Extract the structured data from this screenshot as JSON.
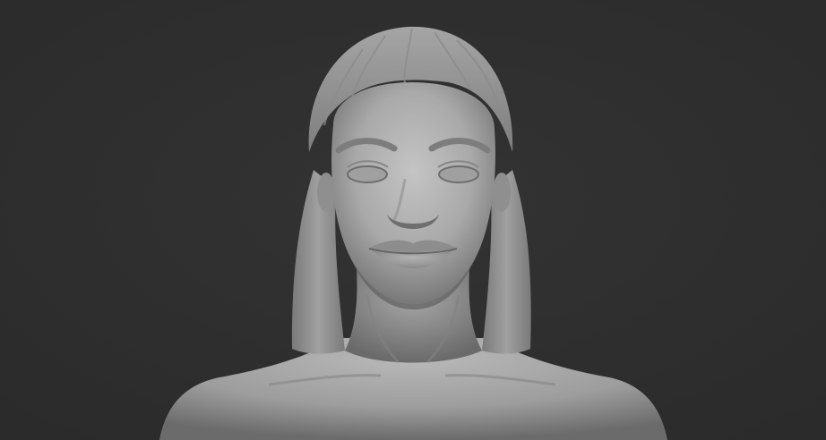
{
  "scene": {
    "subject": "sculpted-female-bust",
    "material": "matcap-gray-clay",
    "background_color": "#2f2f2f",
    "clay_light": "#bdbdbd",
    "clay_mid": "#9a9a9a",
    "clay_dark": "#5c5c5c"
  }
}
